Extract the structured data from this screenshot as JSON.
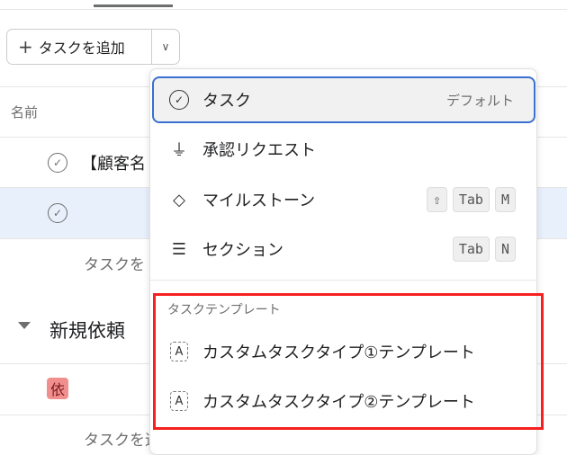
{
  "toolbar": {
    "add_task_label": "タスクを追加",
    "plus_icon": "+",
    "dropdown_icon": "⌄"
  },
  "list": {
    "column_name": "名前",
    "rows": [
      {
        "title": "【顧客名"
      },
      {
        "title": ""
      }
    ],
    "add_task_inline": "タスクを",
    "section": {
      "title": "新規依頼",
      "badge": "依",
      "add_task": "タスクを追加..."
    }
  },
  "menu": {
    "items": [
      {
        "label": "タスク",
        "hint": "デフォルト",
        "icon": "check-circle"
      },
      {
        "label": "承認リクエスト",
        "icon": "stamp"
      },
      {
        "label": "マイルストーン",
        "icon": "diamond",
        "keys": [
          "⇧",
          "Tab",
          "M"
        ]
      },
      {
        "label": "セクション",
        "icon": "section-lines",
        "keys": [
          "Tab",
          "N"
        ]
      }
    ],
    "templates_header": "タスクテンプレート",
    "templates": [
      {
        "label": "カスタムタスクタイプ①テンプレート",
        "icon": "template"
      },
      {
        "label": "カスタムタスクタイプ②テンプレート",
        "icon": "template"
      }
    ]
  },
  "colors": {
    "highlight": "#3b6fd0",
    "annotation": "#f5201f",
    "selected_row": "#e8f0fb"
  }
}
